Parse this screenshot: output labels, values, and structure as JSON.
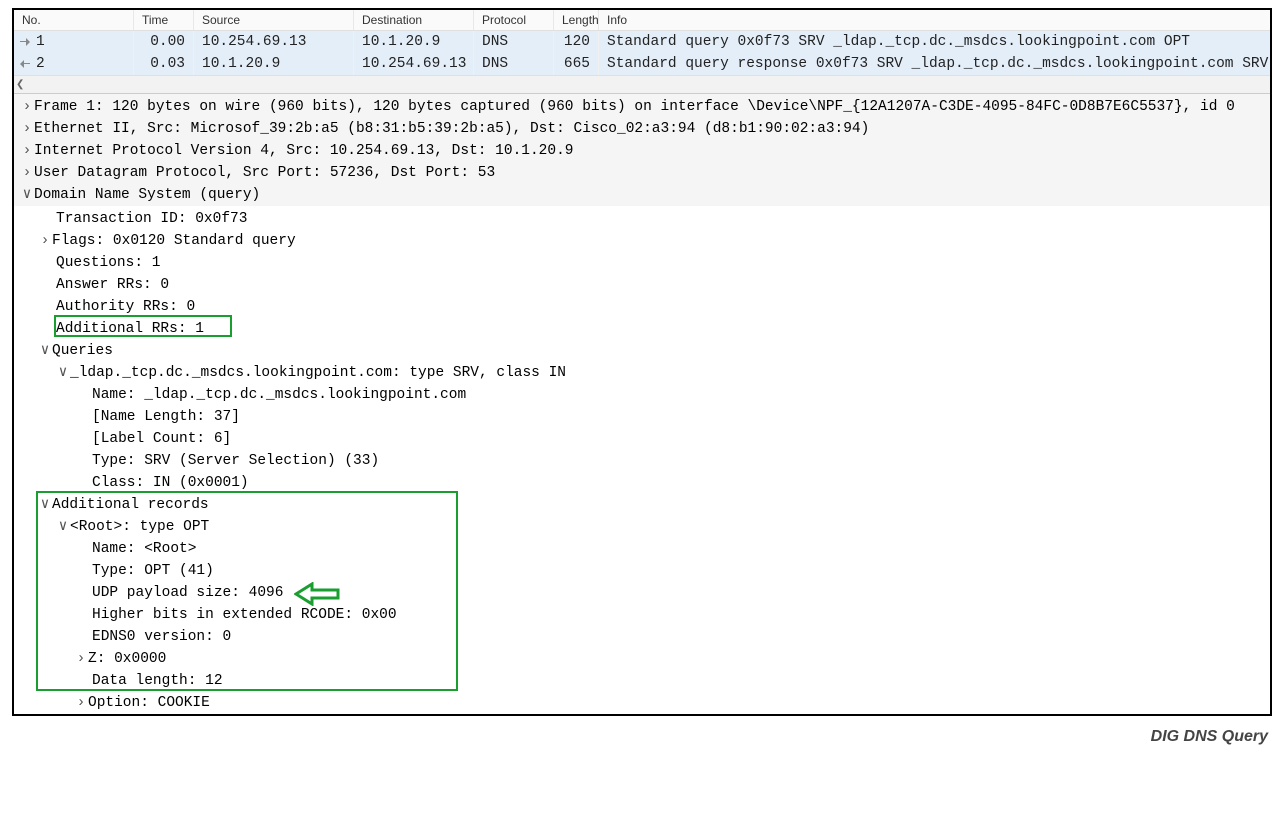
{
  "columns": {
    "no": "No.",
    "time": "Time",
    "source": "Source",
    "destination": "Destination",
    "protocol": "Protocol",
    "length": "Length",
    "info": "Info"
  },
  "packets": [
    {
      "no": "1",
      "time": "0.00",
      "src": "10.254.69.13",
      "dst": "10.1.20.9",
      "proto": "DNS",
      "len": "120",
      "info": "Standard query 0x0f73 SRV _ldap._tcp.dc._msdcs.lookingpoint.com OPT"
    },
    {
      "no": "2",
      "time": "0.03",
      "src": "10.1.20.9",
      "dst": "10.254.69.13",
      "proto": "DNS",
      "len": "665",
      "info": "Standard query response 0x0f73 SRV _ldap._tcp.dc._msdcs.lookingpoint.com SRV"
    }
  ],
  "tree": {
    "frame": "Frame 1: 120 bytes on wire (960 bits), 120 bytes captured (960 bits) on interface \\Device\\NPF_{12A1207A-C3DE-4095-84FC-0D8B7E6C5537}, id 0",
    "eth": "Ethernet II, Src: Microsof_39:2b:a5 (b8:31:b5:39:2b:a5), Dst: Cisco_02:a3:94 (d8:b1:90:02:a3:94)",
    "ip": "Internet Protocol Version 4, Src: 10.254.69.13, Dst: 10.1.20.9",
    "udp": "User Datagram Protocol, Src Port: 57236, Dst Port: 53",
    "dns": "Domain Name System (query)",
    "txid": "Transaction ID: 0x0f73",
    "flags": "Flags: 0x0120 Standard query",
    "questions": "Questions: 1",
    "answerrrs": "Answer RRs: 0",
    "authrrs": "Authority RRs: 0",
    "addlrrs": "Additional RRs: 1",
    "queries": "Queries",
    "query_main": "_ldap._tcp.dc._msdcs.lookingpoint.com: type SRV, class IN",
    "q_name": "Name: _ldap._tcp.dc._msdcs.lookingpoint.com",
    "q_namelen": "[Name Length: 37]",
    "q_labelcount": "[Label Count: 6]",
    "q_type": "Type: SRV (Server Selection) (33)",
    "q_class": "Class: IN (0x0001)",
    "addl": "Additional records",
    "root": "<Root>: type OPT",
    "r_name": "Name: <Root>",
    "r_type": "Type: OPT (41)",
    "r_udp": "UDP payload size: 4096",
    "r_rcode": "Higher bits in extended RCODE: 0x00",
    "r_edns": "EDNS0 version: 0",
    "r_z": "Z: 0x0000",
    "r_datalen": "Data length: 12",
    "r_option": "Option: COOKIE"
  },
  "caption": "DIG DNS Query"
}
